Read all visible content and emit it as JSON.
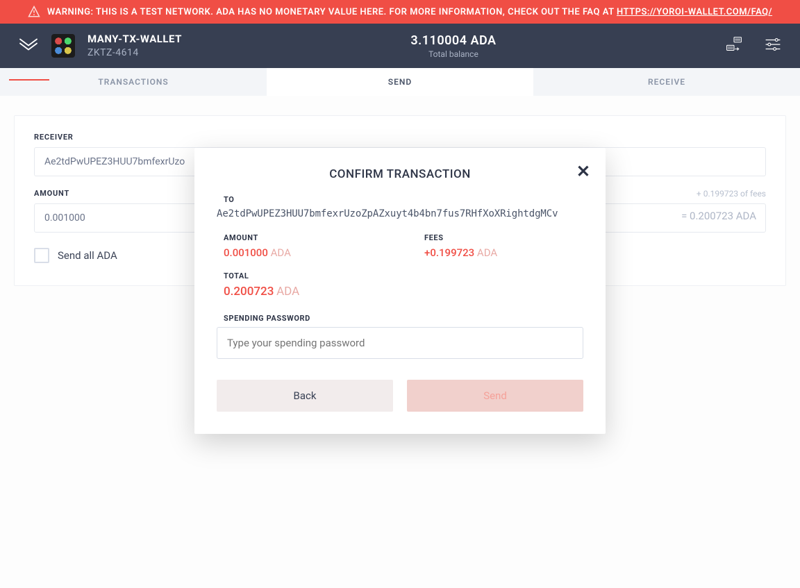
{
  "warning": {
    "text": "WARNING: THIS IS A TEST NETWORK. ADA HAS NO MONETARY VALUE HERE. FOR MORE INFORMATION, CHECK OUT THE FAQ AT ",
    "link": "HTTPS://YOROI-WALLET.COM/FAQ/"
  },
  "wallet": {
    "name": "MANY-TX-WALLET",
    "sub": "ZKTZ-4614",
    "balance": "3.110004 ADA",
    "balance_label": "Total balance"
  },
  "tabs": {
    "transactions": "TRANSACTIONS",
    "send": "SEND",
    "receive": "RECEIVE"
  },
  "form": {
    "receiver_label": "RECEIVER",
    "receiver_value": "Ae2tdPwUPEZ3HUU7bmfexrUzo",
    "amount_label": "AMOUNT",
    "amount_value": "0.001000",
    "fees_hint": "+ 0.199723 of fees",
    "equals_hint": "= 0.200723 ADA",
    "send_all_label": "Send all ADA"
  },
  "modal": {
    "title": "CONFIRM TRANSACTION",
    "to_label": "TO",
    "to_value": "Ae2tdPwUPEZ3HUU7bmfexrUzoZpAZxuyt4b4bn7fus7RHfXoXRightdgMCv",
    "amount_label": "AMOUNT",
    "amount_value": "0.001000",
    "amount_unit": "ADA",
    "fees_label": "FEES",
    "fees_value": "+0.199723",
    "fees_unit": "ADA",
    "total_label": "TOTAL",
    "total_value": "0.200723",
    "total_unit": "ADA",
    "password_label": "SPENDING PASSWORD",
    "password_placeholder": "Type your spending password",
    "back_button": "Back",
    "send_button": "Send"
  }
}
